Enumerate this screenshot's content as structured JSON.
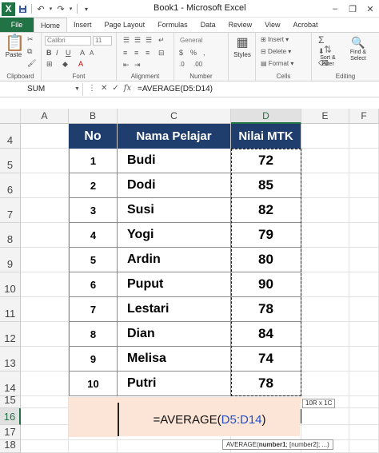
{
  "window": {
    "title": "Book1 - Microsoft Excel",
    "app_icon": "X",
    "qat_icons": [
      "save-icon",
      "undo-icon",
      "redo-icon",
      "customize-icon"
    ],
    "controls": [
      "minimize-icon",
      "restore-icon",
      "close-icon"
    ]
  },
  "tabs": [
    "File",
    "Home",
    "Insert",
    "Page Layout",
    "Formulas",
    "Data",
    "Review",
    "View",
    "Acrobat"
  ],
  "active_tab": "Home",
  "ribbon": {
    "clipboard": {
      "label": "Clipboard",
      "paste": "Paste"
    },
    "font": {
      "label": "Font",
      "name": "Calibri",
      "size": "11"
    },
    "alignment": {
      "label": "Alignment"
    },
    "number": {
      "label": "Number",
      "format": "General"
    },
    "styles": {
      "label": "Styles"
    },
    "cells": {
      "label": "Cells",
      "insert": "Insert",
      "delete": "Delete",
      "format": "Format"
    },
    "editing": {
      "label": "Editing",
      "sort": "Sort & Filter",
      "find": "Find & Select"
    }
  },
  "formula_bar": {
    "name_box": "SUM",
    "formula": "=AVERAGE(D5:D14)"
  },
  "columns": [
    "A",
    "B",
    "C",
    "D",
    "E",
    "F"
  ],
  "rows": [
    "4",
    "5",
    "6",
    "7",
    "8",
    "9",
    "10",
    "11",
    "12",
    "13",
    "14",
    "15",
    "16",
    "17",
    "18"
  ],
  "table": {
    "headers": [
      "No",
      "Nama Pelajar",
      "Nilai MTK"
    ],
    "rows": [
      [
        "1",
        "Budi",
        "72"
      ],
      [
        "2",
        "Dodi",
        "85"
      ],
      [
        "3",
        "Susi",
        "82"
      ],
      [
        "4",
        "Yogi",
        "79"
      ],
      [
        "5",
        "Ardin",
        "80"
      ],
      [
        "6",
        "Puput",
        "90"
      ],
      [
        "7",
        "Lestari",
        "78"
      ],
      [
        "8",
        "Dian",
        "84"
      ],
      [
        "9",
        "Melisa",
        "74"
      ],
      [
        "10",
        "Putri",
        "78"
      ]
    ]
  },
  "edit": {
    "prefix": "=AVERAGE(",
    "range": "D5:D14",
    "suffix": ")"
  },
  "tooltip_size": "10R x 1C",
  "tooltip_args": {
    "func": "AVERAGE(",
    "arg1": "number1",
    "rest": "; [number2]; ...)"
  },
  "colors": {
    "excel_green": "#217346",
    "header_fill": "#1f3d6d",
    "peach": "#fce4d6",
    "range_ref": "#2250c8"
  }
}
